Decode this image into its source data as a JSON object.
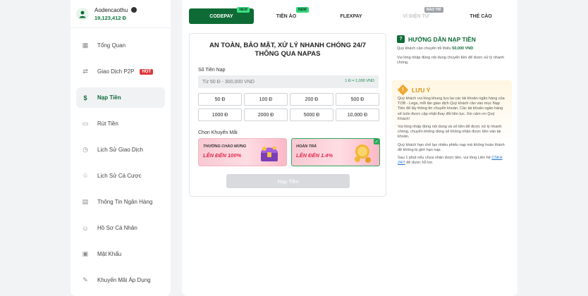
{
  "user": {
    "name": "Aodencaothu",
    "balance": "19,123,412 Đ"
  },
  "sidebar": {
    "items": [
      {
        "label": "Tổng Quan",
        "icon": "grid-icon"
      },
      {
        "label": "Giao Dịch P2P",
        "icon": "p2p-icon",
        "badge": "HOT"
      },
      {
        "label": "Nạp Tiền",
        "icon": "deposit-icon"
      },
      {
        "label": "Rút Tiền",
        "icon": "withdraw-icon"
      },
      {
        "label": "Lịch Sử Giao Dịch",
        "icon": "history-icon"
      },
      {
        "label": "Lịch Sử Cá Cược",
        "icon": "bet-history-icon"
      },
      {
        "label": "Thông Tin Ngân Hàng",
        "icon": "bank-icon"
      },
      {
        "label": "Hồ Sơ Cá Nhân",
        "icon": "profile-icon"
      },
      {
        "label": "Mật Khẩu",
        "icon": "lock-icon"
      },
      {
        "label": "Khuyến Mãi Áp Dụng",
        "icon": "promotion-icon"
      }
    ],
    "active_index": 2
  },
  "tabs": [
    {
      "label": "CODEPAY",
      "badge": "NEW"
    },
    {
      "label": "TIỀN ẢO",
      "badge": "NEW"
    },
    {
      "label": "FLEXPAY"
    },
    {
      "label": "VÍ ĐIỆN TỬ",
      "badge": "BẢO TRÌ"
    },
    {
      "label": "THẺ CÀO"
    }
  ],
  "deposit": {
    "title_line1": "AN TOÀN, BẢO MẬT, XỬ LÝ NHANH CHÓNG 24/7",
    "title_line2": "THÔNG QUA NAPAS",
    "amount_label": "Số Tiền Nạp",
    "amount_placeholder": "Từ 50 Đ - 300,000 VND",
    "rate": "1 Đ = 1,000 VND",
    "amounts": [
      "50 Đ",
      "100 Đ",
      "200 Đ",
      "500 Đ",
      "1000 Đ",
      "2000 Đ",
      "5000 Đ",
      "10,000 Đ"
    ],
    "promo_label": "Chọn Khuyến Mãi",
    "promos": [
      {
        "sub": "THƯỞNG CHÀO MỪNG",
        "main": "LÊN ĐẾN 100%"
      },
      {
        "sub": "HOÀN TRẢ",
        "main": "LÊN ĐẾN 1.4%",
        "selected": true
      }
    ],
    "submit_label": "Nạp Tiền"
  },
  "guide": {
    "title": "HƯỚNG DẪN NẠP TIỀN",
    "line1_prefix": "Quý khách cần chuyển tối thiểu ",
    "line1_amount": "50,000 VND",
    "line2": "Vui lòng nhập đúng nội dung chuyển tiền để được xử lý nhanh chóng."
  },
  "note": {
    "title": "LƯU Ý",
    "p1": "Quý khách vui lòng khung lưu lại các tài khoản ngân hàng của TOB - Lega, mỗi lần giao dịch Quý khách cần vào mục Nạp Tiền để lấy thông tin chuyển khoản. Các tài khoản ngân hàng sẽ luôn được cập nhật thay đổi liên tục. Xin cảm ơn Quý Khách!",
    "p2": "Vui lòng nhập đúng nội dung và số tiền để được xử lý nhanh chóng, chuyển không đúng sẽ không nhận được tiền vào tài khoản.",
    "p3": "Quý khách hạn chế lạo nhiều phiếu nạp mà không hoàn thành để không bị giới hạn nạp.",
    "p4_prefix": "Sau 1 phút nếu chưa nhận được tiền, vui lòng Liên hệ ",
    "p4_link": "CSKH 24/7",
    "p4_suffix": " để được hỗ trợ."
  },
  "colors": {
    "brand": "#0e6b35",
    "hot": "#e0393e",
    "warning": "#e0921a"
  }
}
